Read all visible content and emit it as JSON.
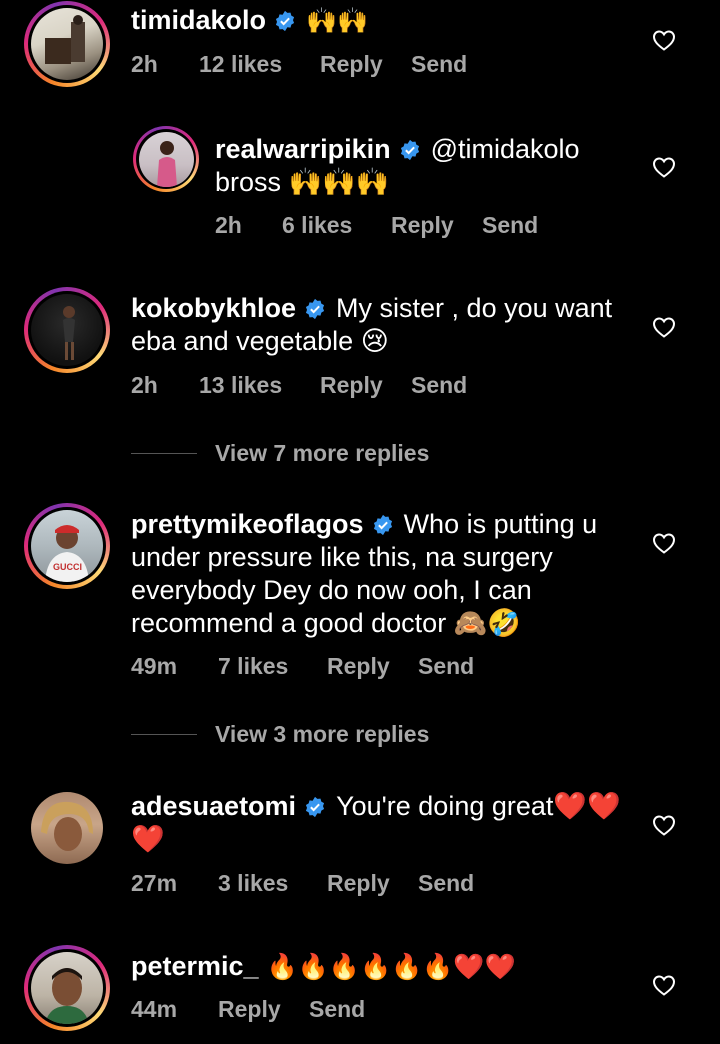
{
  "comments": [
    {
      "username": "timidakolo",
      "text": "🙌🙌",
      "time": "2h",
      "likes": "12 likes",
      "reply": "Reply",
      "send": "Send"
    },
    {
      "username": "realwarripikin",
      "mention": "@timidakolo",
      "text": "bross 🙌🙌🙌",
      "time": "2h",
      "likes": "6 likes",
      "reply": "Reply",
      "send": "Send"
    },
    {
      "username": "kokobykhloe",
      "text": "My sister , do you want eba and vegetable 😢",
      "time": "2h",
      "likes": "13 likes",
      "reply": "Reply",
      "send": "Send",
      "view_more": "View 7 more replies"
    },
    {
      "username": "prettymikeoflagos",
      "text": "Who is putting u under pressure like this, na surgery everybody Dey do now ooh, I can recommend a good doctor 🙈🤣",
      "time": "49m",
      "likes": "7 likes",
      "reply": "Reply",
      "send": "Send",
      "view_more": "View 3 more replies"
    },
    {
      "username": "adesuaetomi",
      "text": "You're doing great❤️❤️❤️",
      "time": "27m",
      "likes": "3 likes",
      "reply": "Reply",
      "send": "Send"
    },
    {
      "username": "petermic_",
      "text": "🔥🔥🔥🔥🔥🔥❤️❤️",
      "time": "44m",
      "reply": "Reply",
      "send": "Send"
    }
  ],
  "colors": {
    "background": "#000000",
    "meta_text": "#a8a8a8",
    "verified_blue": "#3897f0"
  },
  "icons": {
    "like": "heart-outline-icon",
    "verified": "verified-badge-icon"
  }
}
